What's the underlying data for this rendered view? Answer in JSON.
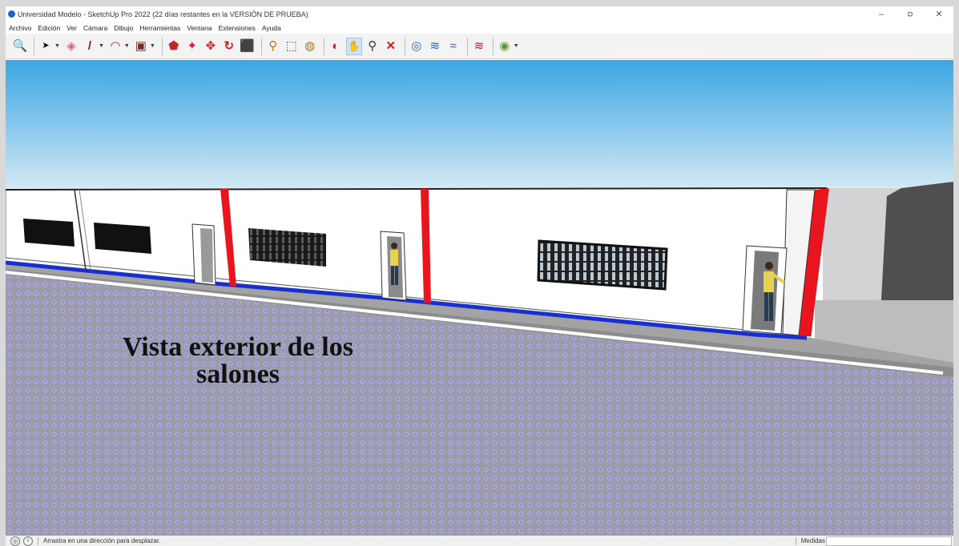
{
  "window": {
    "title": "Universidad Modelo - SketchUp Pro 2022 (22 días restantes en la VERSIÓN DE PRUEBA)",
    "controls": {
      "minimize": "–",
      "restore": "ᴑ",
      "close": "✕"
    }
  },
  "menu": [
    "Archivo",
    "Edición",
    "Ver",
    "Cámara",
    "Dibujo",
    "Herramientas",
    "Ventana",
    "Extensiones",
    "Ayuda"
  ],
  "toolbar": {
    "tools": [
      {
        "name": "search-tool",
        "glyph": "🔍"
      },
      {
        "name": "select-tool",
        "glyph": "➤"
      },
      {
        "name": "eraser-tool",
        "glyph": "◈"
      },
      {
        "name": "line-tool",
        "glyph": "/"
      },
      {
        "name": "arc-tool",
        "glyph": "◠"
      },
      {
        "name": "rectangle-tool",
        "glyph": "▣"
      },
      {
        "name": "push-pull-tool",
        "glyph": "⬟"
      },
      {
        "name": "follow-me-tool",
        "glyph": "✦"
      },
      {
        "name": "move-tool",
        "glyph": "✥"
      },
      {
        "name": "rotate-tool",
        "glyph": "↻"
      },
      {
        "name": "scale-tool",
        "glyph": "⬛"
      },
      {
        "name": "tape-measure-tool",
        "glyph": "⚲"
      },
      {
        "name": "text-tool",
        "glyph": "⬚"
      },
      {
        "name": "paint-bucket-tool",
        "glyph": "◍"
      },
      {
        "name": "orbit-tool",
        "glyph": "◐"
      },
      {
        "name": "pan-tool",
        "glyph": "✋"
      },
      {
        "name": "zoom-tool",
        "glyph": "⚲"
      },
      {
        "name": "zoom-extents-tool",
        "glyph": "✕"
      },
      {
        "name": "warehouse-tool",
        "glyph": "◎"
      },
      {
        "name": "extension-warehouse-tool",
        "glyph": "≋"
      },
      {
        "name": "layout-tool",
        "glyph": "≈"
      },
      {
        "name": "extension-manager-tool",
        "glyph": "≋"
      },
      {
        "name": "account-tool",
        "glyph": "◉"
      }
    ],
    "active_tool": "pan-tool"
  },
  "viewport": {
    "caption_line1": "Vista exterior de los",
    "caption_line2": "salones"
  },
  "status": {
    "hint": "Arrastra en una dirección para desplazar.",
    "measure_label": "Medidas",
    "measure_value": ""
  },
  "colors": {
    "sky_top": "#3aa6e3",
    "sky_bottom": "#d8eaf5",
    "wall": "#ffffff",
    "accent_red": "#e8141e",
    "base_blue": "#1a2fd0",
    "ground": "#9a9aa6",
    "active_tool_bg": "#cfe3f8"
  }
}
